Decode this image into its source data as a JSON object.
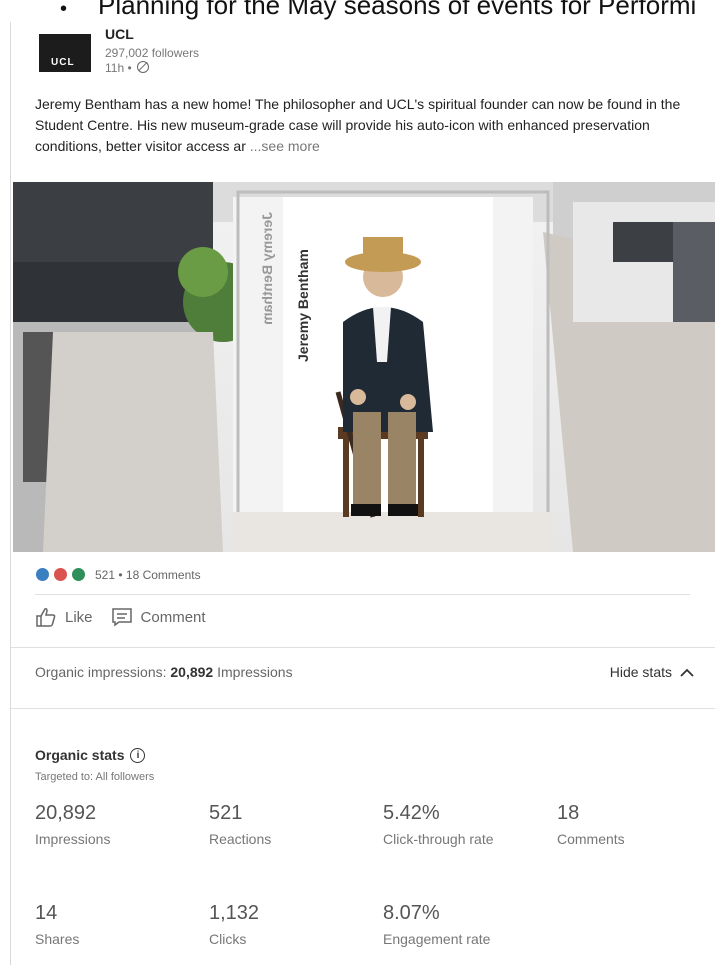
{
  "doc_line": "Planning for the May seasons of events for Performi",
  "post": {
    "org_name": "UCL",
    "logo_text": "UCL",
    "followers": "297,002 followers",
    "time": "11h •",
    "text": "Jeremy Bentham has a new home! The philosopher and UCL's spiritual founder can now be found in the Student Centre. His new museum-grade case will provide his auto-icon with enhanced preservation conditions, better visitor access ar",
    "see_more": "...see more",
    "image_sign_text": "Jeremy Bentham",
    "image_sign_mirror": "Jeremy Bentham"
  },
  "social": {
    "summary": "521 • 18 Comments",
    "like_label": "Like",
    "comment_label": "Comment"
  },
  "impressions": {
    "label": "Organic impressions:",
    "value": "20,892",
    "unit": "Impressions",
    "hide_label": "Hide stats"
  },
  "organic": {
    "title": "Organic stats",
    "targeted": "Targeted to: All followers",
    "stats": [
      {
        "value": "20,892",
        "label": "Impressions"
      },
      {
        "value": "521",
        "label": "Reactions"
      },
      {
        "value": "5.42%",
        "label": "Click-through rate"
      },
      {
        "value": "18",
        "label": "Comments"
      },
      {
        "value": "14",
        "label": "Shares"
      },
      {
        "value": "1,132",
        "label": "Clicks"
      },
      {
        "value": "8.07%",
        "label": "Engagement rate"
      }
    ]
  },
  "colors": {
    "like": "#3a7fc1",
    "love": "#d9534f",
    "insight": "#2f8f5b"
  }
}
